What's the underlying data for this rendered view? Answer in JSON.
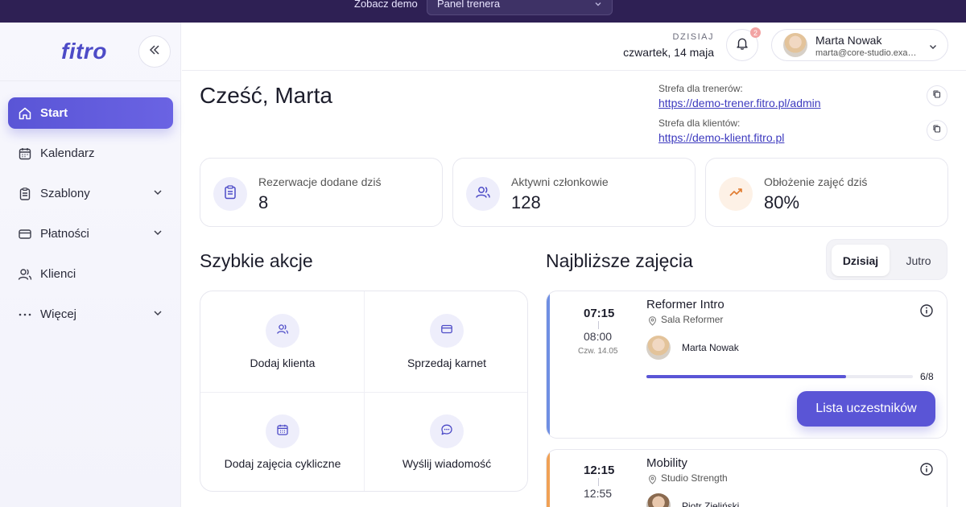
{
  "demo_bar": {
    "label": "Zobacz demo",
    "selected": "Panel trenera"
  },
  "brand": {
    "logo": "fitro"
  },
  "sidebar": {
    "items": [
      {
        "label": "Start",
        "icon": "home-icon",
        "active": true
      },
      {
        "label": "Kalendarz",
        "icon": "calendar-icon"
      },
      {
        "label": "Szablony",
        "icon": "clipboard-icon",
        "expandable": true
      },
      {
        "label": "Płatności",
        "icon": "credit-card-icon",
        "expandable": true
      },
      {
        "label": "Klienci",
        "icon": "users-icon"
      },
      {
        "label": "Więcej",
        "icon": "more-dots-icon",
        "expandable": true
      }
    ]
  },
  "header": {
    "today_label": "DZISIAJ",
    "today_date": "czwartek, 14 maja",
    "notifications": "2",
    "user": {
      "name": "Marta Nowak",
      "email": "marta@core-studio.example"
    }
  },
  "main": {
    "greeting": "Cześć, Marta",
    "zones": [
      {
        "label": "Strefa dla trenerów:",
        "url": "https://demo-trener.fitro.pl/admin"
      },
      {
        "label": "Strefa dla klientów:",
        "url": "https://demo-klient.fitro.pl"
      }
    ],
    "stats": [
      {
        "label": "Rezerwacje dodane dziś",
        "value": "8",
        "color": "#eeeefb"
      },
      {
        "label": "Aktywni członkowie",
        "value": "128",
        "color": "#eeeefb"
      },
      {
        "label": "Obłożenie zajęć dziś",
        "value": "80%",
        "color": "#fdf1e6"
      }
    ],
    "quick_title": "Szybkie akcje",
    "quick_actions": [
      {
        "label": "Dodaj klienta",
        "icon": "user-plus-icon"
      },
      {
        "label": "Sprzedaj karnet",
        "icon": "credit-card-icon"
      },
      {
        "label": "Dodaj zajęcia cykliczne",
        "icon": "calendar-repeat-icon"
      },
      {
        "label": "Wyślij wiadomość",
        "icon": "message-icon"
      }
    ],
    "classes_title": "Najbliższe zajęcia",
    "toggle": {
      "on": "Dzisiaj",
      "off": "Jutro"
    },
    "classes": [
      {
        "start": "07:15",
        "end": "08:00",
        "date": "Czw. 14.05",
        "name": "Reformer Intro",
        "room": "Sala Reformer",
        "trainer": "Marta Nowak",
        "capacity": "6/8",
        "fill": 0.75,
        "accent": "#6f8fe3",
        "button": "Lista uczestników"
      },
      {
        "start": "12:15",
        "end": "12:55",
        "date": "",
        "name": "Mobility",
        "room": "Studio Strength",
        "trainer": "Piotr Zieliński",
        "accent": "#f0a155"
      }
    ]
  },
  "colors": {
    "accent": "#5a55d6",
    "header_bg": "#2e2054"
  }
}
